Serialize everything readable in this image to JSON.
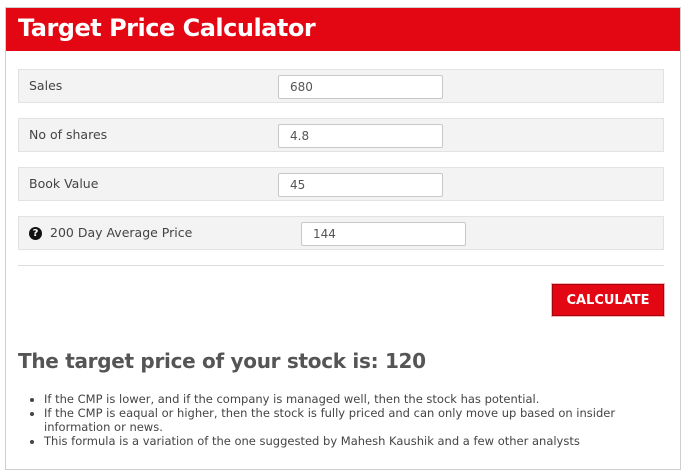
{
  "header": {
    "title": "Target Price Calculator"
  },
  "form": {
    "fields": [
      {
        "label": "Sales",
        "value": "680"
      },
      {
        "label": "No of shares",
        "value": "4.8"
      },
      {
        "label": "Book Value",
        "value": "45"
      },
      {
        "label": "200 Day Average Price",
        "value": "144",
        "icon": "question-circle-icon",
        "icon_glyph": "?"
      }
    ],
    "calculate_label": "CALCULATE"
  },
  "result": {
    "text": "The target price of your stock is: 120"
  },
  "notes": [
    "If the CMP is lower, and if the company is managed well, then the stock has potential.",
    "If the CMP is eaqual or higher, then the stock is fully priced and can only move up based on insider information or news.",
    "This formula is a variation of the one suggested by Mahesh Kaushik and a few other analysts"
  ],
  "colors": {
    "accent": "#e30613",
    "row_bg": "#f3f3f3",
    "text": "#444444"
  }
}
